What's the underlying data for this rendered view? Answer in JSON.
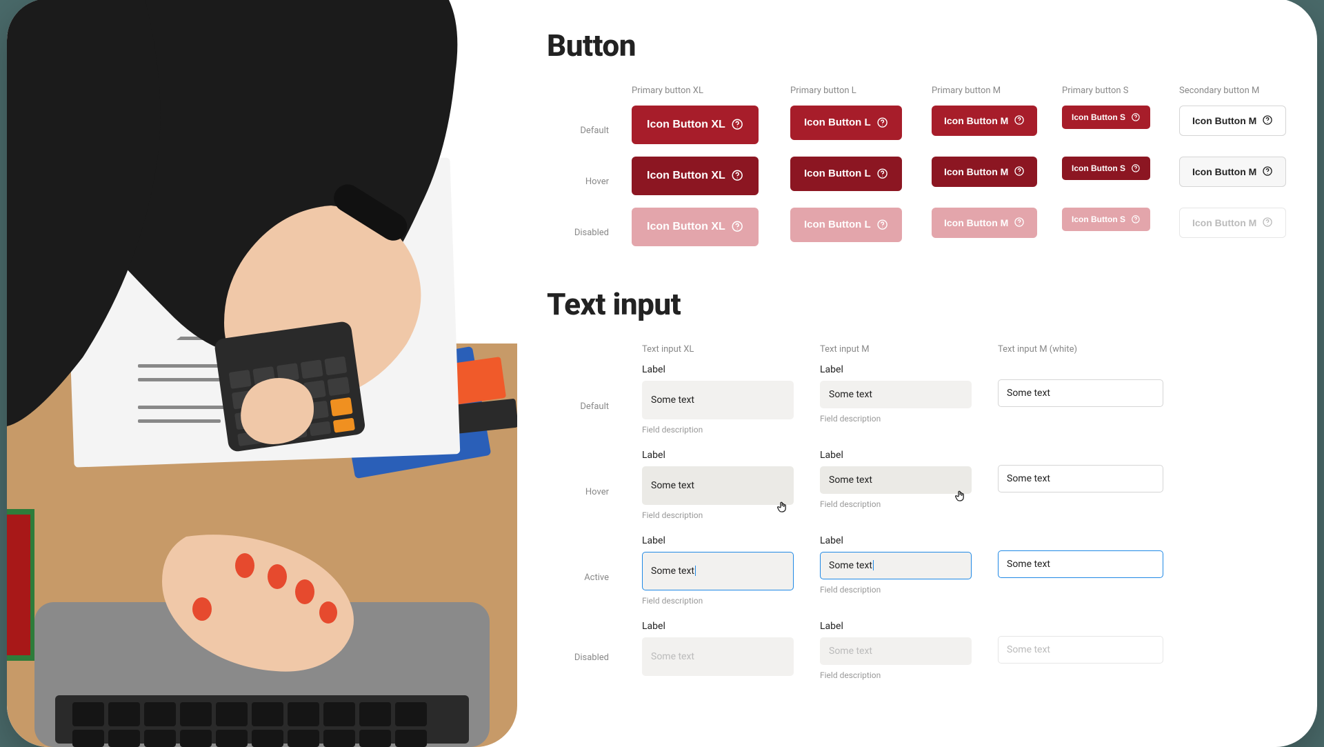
{
  "sections": {
    "button": "Button",
    "textinput": "Text input"
  },
  "states": {
    "default": "Default",
    "hover": "Hover",
    "active": "Active",
    "disabled": "Disabled"
  },
  "button_columns": {
    "xl": "Primary button XL",
    "l": "Primary button L",
    "m": "Primary button M",
    "s": "Primary button S",
    "sec_m": "Secondary button M"
  },
  "button_labels": {
    "xl": "Icon Button XL",
    "l": "Icon Button L",
    "m": "Icon Button M",
    "s": "Icon Button S",
    "sec_m": "Icon Button M"
  },
  "input_columns": {
    "xl": "Text input XL",
    "m": "Text input M",
    "mw": "Text input M (white)"
  },
  "field": {
    "label": "Label",
    "value": "Some text",
    "placeholder": "Some text",
    "desc": "Field description"
  },
  "colors": {
    "primary": "#a71d2a",
    "primary_hover": "#8c1622",
    "primary_disabled": "#e3a5ab",
    "focus": "#1e88e5"
  }
}
